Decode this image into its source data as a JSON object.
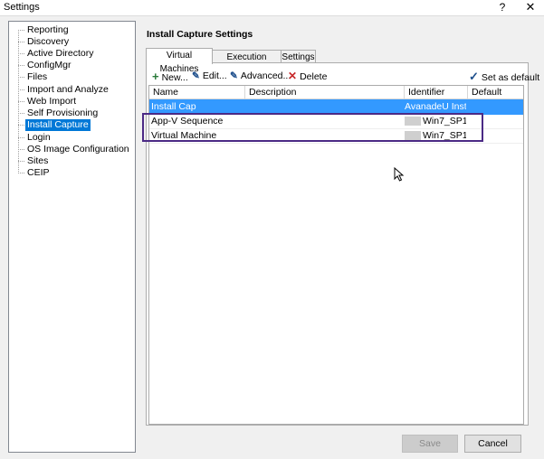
{
  "window": {
    "title": "Settings",
    "help_glyph": "?",
    "close_glyph": "✕"
  },
  "tree": {
    "items": [
      {
        "label": "Reporting"
      },
      {
        "label": "Discovery"
      },
      {
        "label": "Active Directory"
      },
      {
        "label": "ConfigMgr"
      },
      {
        "label": "Files"
      },
      {
        "label": "Import and Analyze"
      },
      {
        "label": "Web Import"
      },
      {
        "label": "Self Provisioning"
      },
      {
        "label": "Install Capture",
        "selected": true
      },
      {
        "label": "Login"
      },
      {
        "label": "OS Image Configuration"
      },
      {
        "label": "Sites"
      },
      {
        "label": "CEIP"
      }
    ]
  },
  "main": {
    "heading": "Install Capture Settings",
    "tabs": [
      {
        "label": "Virtual Machines",
        "active": true
      },
      {
        "label": "Execution Profiles"
      },
      {
        "label": "Settings"
      }
    ],
    "toolbar": {
      "new_label": "New...",
      "edit_label": "Edit...",
      "advanced_label": "Advanced...",
      "delete_label": "Delete",
      "set_default_label": "Set as default"
    },
    "grid": {
      "columns": [
        "Name",
        "Description",
        "Identifier",
        "Default"
      ],
      "rows": [
        {
          "name": "Install Cap",
          "description": "",
          "identifier": "AvanadeU Inst...",
          "default": "",
          "selected": true
        },
        {
          "name": "App-V Sequence",
          "description": "",
          "identifier": "Win7_SP1...",
          "default": ""
        },
        {
          "name": "Virtual Machine",
          "description": "",
          "identifier": "Win7_SP1...",
          "default": ""
        }
      ]
    }
  },
  "footer": {
    "save_label": "Save",
    "cancel_label": "Cancel"
  },
  "colors": {
    "selection": "#0078d7",
    "row_selection": "#3399ff",
    "highlight_box": "#4b2a85"
  }
}
